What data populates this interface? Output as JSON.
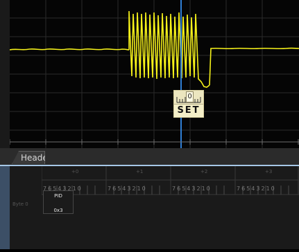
{
  "tabs": [
    {
      "label": "Header"
    }
  ],
  "marker": {
    "value": "0",
    "label": "SET"
  },
  "decoder": {
    "columns": [
      "+0",
      "+1",
      "+2",
      "+3"
    ],
    "bit_order": [
      "7",
      "6",
      "5",
      "4",
      "3",
      "2",
      "1",
      "0"
    ],
    "rows": [
      {
        "label": "Byte 0"
      }
    ],
    "fields": [
      {
        "name": "PID",
        "value": "0x3"
      }
    ]
  },
  "colors": {
    "trace": "#f6f21a",
    "cursor": "#2f7fd6",
    "grid": "#2a2a2a",
    "accent": "#a6c7e6"
  }
}
